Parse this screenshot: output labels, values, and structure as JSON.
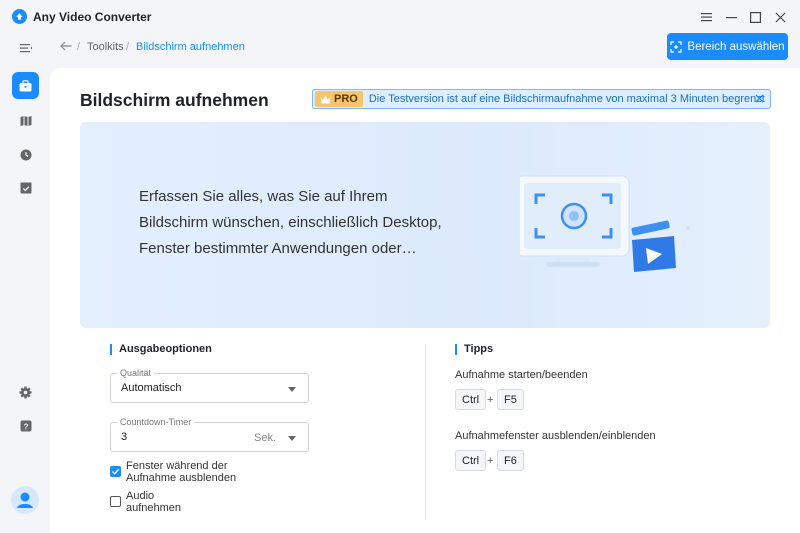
{
  "app": {
    "title": "Any Video Converter"
  },
  "window_controls": [
    "menu-icon",
    "minimize-icon",
    "maximize-icon",
    "close-icon"
  ],
  "breadcrumb": {
    "items": [
      "Toolkits",
      "Bildschirm aufnehmen"
    ],
    "separator": "/"
  },
  "header": {
    "region_button": "Bereich auswählen"
  },
  "sidebar": {
    "items": [
      "collapse-menu-icon",
      "toolbox-icon",
      "map-icon",
      "history-icon",
      "tasks-icon",
      "settings-icon",
      "help-icon",
      "avatar-icon"
    ]
  },
  "page": {
    "title": "Bildschirm aufnehmen"
  },
  "pro_banner": {
    "badge": "PRO",
    "text": "Die Testversion ist auf eine Bildschirmaufnahme von maximal 3 Minuten begrenzt"
  },
  "hero": {
    "lines": [
      "Erfassen Sie alles, was Sie auf Ihrem",
      "Bildschirm wünschen, einschließlich Desktop,",
      "Fenster bestimmter Anwendungen oder…"
    ]
  },
  "output": {
    "title": "Ausgabeoptionen",
    "quality": {
      "label": "Qualität",
      "value": "Automatisch"
    },
    "countdown": {
      "label": "Countdown-Timer",
      "value": "3",
      "unit": "Sek."
    },
    "hide_window": {
      "label": "Fenster während der Aufnahme ausblenden",
      "checked": true
    },
    "audio": {
      "label": "Audio aufnehmen",
      "checked": false
    }
  },
  "tips": {
    "title": "Tipps",
    "items": [
      {
        "label": "Aufnahme starten/beenden",
        "keys": [
          "Ctrl",
          "F5"
        ]
      },
      {
        "label": "Aufnahmefenster ausblenden/einblenden",
        "keys": [
          "Ctrl",
          "F6"
        ]
      }
    ],
    "plus": "+"
  },
  "colors": {
    "accent": "#1a8cff",
    "pro_badge": "#f6c46b",
    "banner_bg": "#dceeff"
  }
}
